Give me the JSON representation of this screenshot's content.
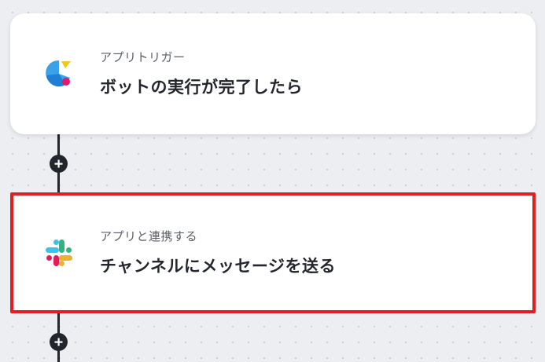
{
  "steps": [
    {
      "label": "アプリトリガー",
      "title": "ボットの実行が完了したら",
      "icon": "bot-app-icon"
    },
    {
      "label": "アプリと連携する",
      "title": "チャンネルにメッセージを送る",
      "icon": "slack-icon"
    }
  ],
  "colors": {
    "highlight_border": "#e02020",
    "connector": "#22252b"
  }
}
